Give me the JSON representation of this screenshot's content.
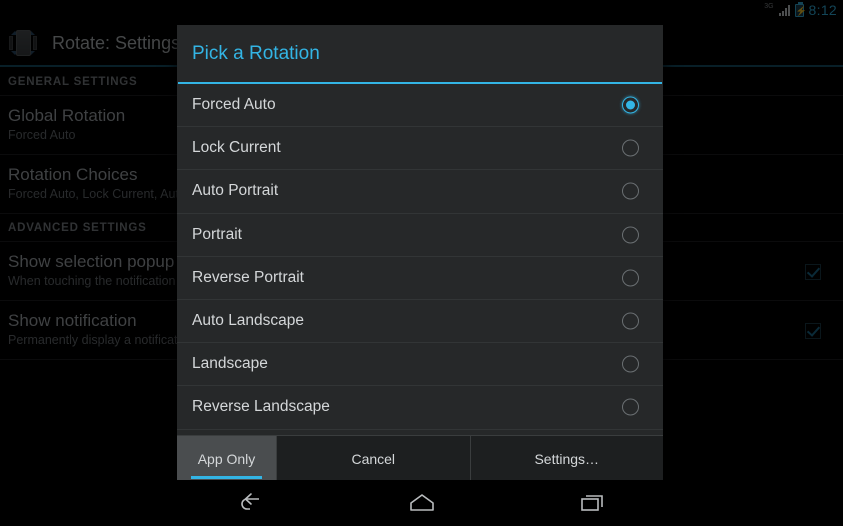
{
  "status_bar": {
    "network_label": "3G",
    "battery_icon": "battery-charging-icon",
    "signal_icon": "signal-bars-icon",
    "time": "8:12"
  },
  "action_bar": {
    "icon": "rotate-app-icon",
    "title": "Rotate: Settings"
  },
  "settings": {
    "sections": [
      {
        "header": "GENERAL SETTINGS",
        "items": [
          {
            "title": "Global Rotation",
            "summary": "Forced Auto",
            "checkbox": false
          },
          {
            "title": "Rotation Choices",
            "summary": "Forced Auto, Lock Current, Auto Portrait",
            "checkbox": false
          }
        ]
      },
      {
        "header": "ADVANCED SETTINGS",
        "items": [
          {
            "title": "Show selection popup",
            "summary": "When touching the notification",
            "checkbox": true
          },
          {
            "title": "Show notification",
            "summary": "Permanently display a notification",
            "checkbox": true
          }
        ]
      }
    ]
  },
  "dialog": {
    "title": "Pick a Rotation",
    "selected_index": 0,
    "options": [
      {
        "label": "Forced Auto",
        "selected": true
      },
      {
        "label": "Lock Current",
        "selected": false
      },
      {
        "label": "Auto Portrait",
        "selected": false
      },
      {
        "label": "Portrait",
        "selected": false
      },
      {
        "label": "Reverse Portrait",
        "selected": false
      },
      {
        "label": "Auto Landscape",
        "selected": false
      },
      {
        "label": "Landscape",
        "selected": false
      },
      {
        "label": "Reverse Landscape",
        "selected": false
      }
    ],
    "buttons": [
      {
        "label": "App Only",
        "pressed": true
      },
      {
        "label": "Cancel",
        "pressed": false
      },
      {
        "label": "Settings…",
        "pressed": false
      }
    ]
  },
  "nav_bar": {
    "back": "back-icon",
    "home": "home-icon",
    "recents": "recents-icon"
  },
  "colors": {
    "accent": "#33b5e5",
    "dialog_bg": "#262829",
    "screen_bg": "#000000"
  }
}
